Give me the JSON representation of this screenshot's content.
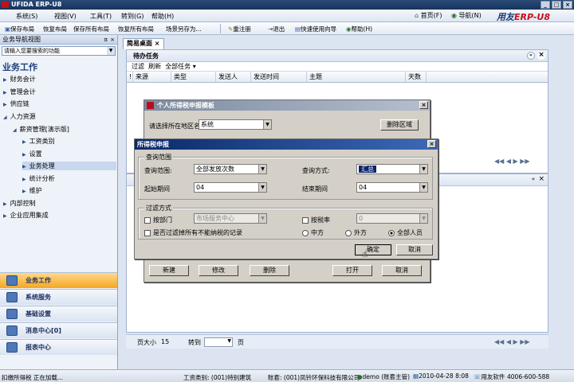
{
  "app": {
    "title": "UFIDA ERP-U8",
    "brand": "用友ERP-U8"
  },
  "menus": [
    "系统(S)",
    "视图(V)",
    "工具(T)",
    "转到(G)",
    "帮助(H)"
  ],
  "top_right": {
    "home": "首页(F)",
    "nav": "导航(N)"
  },
  "toolbar": [
    "保存布局",
    "恢复布局",
    "保存所有布局",
    "恢复所有布局",
    "场景另存为...",
    "重注册",
    "退出",
    "快速使用向导",
    "帮助(H)"
  ],
  "nav": {
    "header": "业务导航视图",
    "search_placeholder": "请输入您要搜索的功能",
    "title": "业务工作",
    "items": [
      "财务会计",
      "管理会计",
      "供应链",
      "人力资源",
      "薪资管理[演示版]",
      "工资类别",
      "设置",
      "业务处理",
      "统计分析",
      "维护",
      "内部控制",
      "企业应用集成"
    ],
    "bottom": [
      "业务工作",
      "系统服务",
      "基础设置",
      "消息中心[0]",
      "报表中心"
    ]
  },
  "tab": "简易桌面",
  "panel": {
    "title": "待办任务",
    "bar": [
      "过滤",
      "刷新",
      "全部任务"
    ],
    "columns": [
      "来源",
      "类型",
      "发送人",
      "发送时间",
      "主题",
      "天数"
    ]
  },
  "pager": {
    "size_label": "页大小",
    "size": "15",
    "goto": "转到",
    "page": "页"
  },
  "template_dialog": {
    "title": "个人所得税申报模板",
    "region_label": "请选择所在地区名",
    "region_value": "系统",
    "delete_region": "删除区域",
    "buttons": [
      "新建",
      "修改",
      "删除",
      "打开",
      "取消"
    ]
  },
  "dialog": {
    "title": "所得税申报",
    "query_group": "查询范围",
    "scope_label": "查询范围:",
    "scope_value": "全部发放次数",
    "method_label": "查询方式:",
    "method_value": "汇总",
    "start_label": "起始期间",
    "start_value": "04",
    "end_label": "结束期间",
    "end_value": "04",
    "filter_group": "过滤方式",
    "by_dept": "按部门",
    "dept_value": "市场服务中心",
    "by_rate": "按税率",
    "rate_value": "0",
    "filter_note": "是否过滤掉所有不能纳税的记录",
    "radios": [
      "中方",
      "外方",
      "全部人员"
    ],
    "ok": "确定",
    "cancel": "取消"
  },
  "status": {
    "left": "扣缴所得税 正在加载...",
    "category": "工资类别: (001)特别建筑",
    "account": "账套: (001)凤钤环保科技有限公司",
    "user": "demo (账套主管)",
    "date": "2010-04-28 8:08",
    "company": "用友软件",
    "phone": "4006-600-588"
  },
  "colors": {
    "accent": "#16345e",
    "active_tab": "#f5a623"
  }
}
